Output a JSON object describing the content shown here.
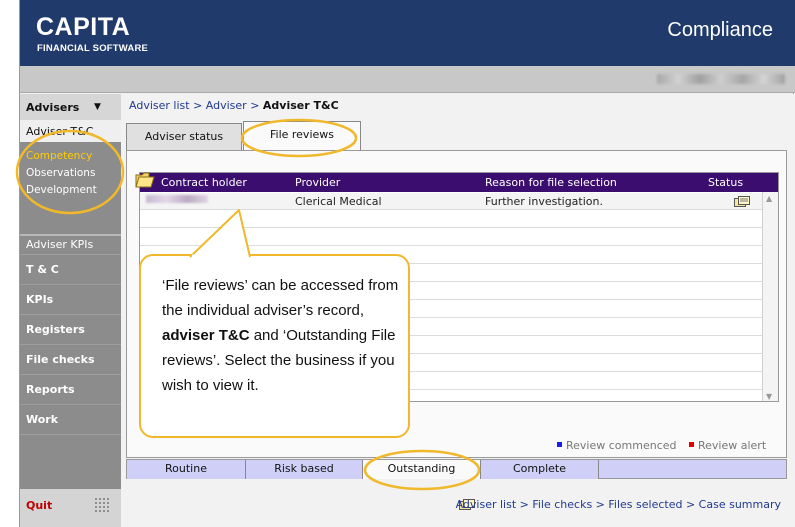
{
  "header": {
    "logo_main": "CAPITA",
    "logo_sub": "FINANCIAL SOFTWARE",
    "title": "Compliance"
  },
  "sidebar": {
    "section": "Advisers",
    "active_item": "Adviser T&C",
    "sub_items": [
      "Competency",
      "Observations",
      "Development"
    ],
    "highlight_color": "#ffcc00",
    "items": [
      "Adviser KPIs",
      "T & C",
      "KPIs",
      "Registers",
      "File checks",
      "Reports",
      "Work"
    ],
    "quit": "Quit"
  },
  "breadcrumb": {
    "link1": "Adviser list",
    "link2": "Adviser",
    "current": "Adviser T&C",
    "sep": ">"
  },
  "tabs": [
    "Adviser status",
    "File reviews"
  ],
  "table": {
    "headers": [
      "Contract holder",
      "Provider",
      "Reason for file selection",
      "Status"
    ],
    "rows": [
      {
        "provider": "Clerical Medical",
        "reason": "Further investigation."
      }
    ],
    "header_color": "#3b0d6e"
  },
  "legend": {
    "commenced": "Review commenced",
    "alert": "Review alert",
    "commenced_color": "#1a1aff",
    "alert_color": "#e00000"
  },
  "bottom_tabs": [
    "Routine",
    "Risk based",
    "Outstanding",
    "Complete"
  ],
  "footer_link": "Adviser list > File checks > Files selected > Case summary",
  "callout": {
    "part1": "‘File reviews’ can be accessed from the individual adviser’s record, ",
    "bold": "adviser T&C",
    "part2": " and ‘Outstanding File reviews’. Select the business if you wish to view it.",
    "border_color": "#f0b82a"
  }
}
